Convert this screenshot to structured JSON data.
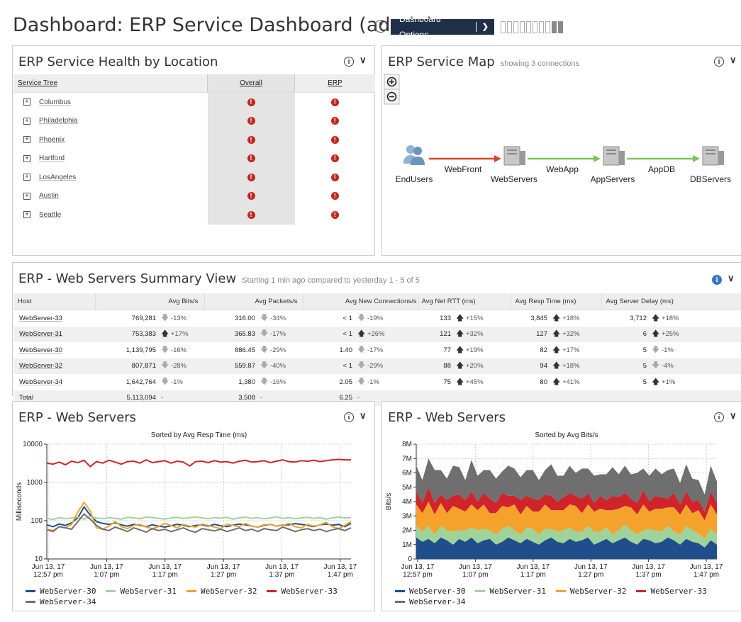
{
  "header": {
    "title": "Dashboard: ERP Service Dashboard (admin)",
    "help_icon": "?",
    "options_label": "Dashboard Options"
  },
  "health": {
    "title": "ERP Service Health by Location",
    "columns": [
      "Service Tree",
      "Overall",
      "ERP"
    ],
    "rows": [
      {
        "location": "Columbus",
        "overall": "!",
        "erp": "!"
      },
      {
        "location": "Philadelphia",
        "overall": "!",
        "erp": "!"
      },
      {
        "location": "Phoenix",
        "overall": "!",
        "erp": "!"
      },
      {
        "location": "Hartford",
        "overall": "!",
        "erp": "!"
      },
      {
        "location": "LosAngeles",
        "overall": "!",
        "erp": "!"
      },
      {
        "location": "Austin",
        "overall": "!",
        "erp": "!"
      },
      {
        "location": "Seattle",
        "overall": "!",
        "erp": "!"
      }
    ]
  },
  "service_map": {
    "title": "ERP Service Map",
    "subtitle": "showing 3 connections",
    "nodes": [
      "EndUsers",
      "WebServers",
      "AppServers",
      "DBServers"
    ],
    "edges": [
      {
        "label": "WebFront",
        "color": "#d9442a"
      },
      {
        "label": "WebApp",
        "color": "#7cc35a"
      },
      {
        "label": "AppDB",
        "color": "#7cc35a"
      }
    ]
  },
  "summary": {
    "title": "ERP - Web Servers Summary View",
    "subtitle": "Starting 1 min ago compared to yesterday 1 - 5 of 5",
    "columns": [
      "Host",
      "Avg Bits/s",
      "Avg Packets/s",
      "Avg New Connections/s",
      "Avg Net RTT (ms)",
      "Avg Resp Time (ms)",
      "Avg Server Delay (ms)"
    ],
    "rows": [
      {
        "host": "WebServer-33",
        "bits": "769,281",
        "bits_chg": "-13%",
        "bits_dir": "down",
        "pkts": "316.00",
        "pkts_chg": "-34%",
        "pkts_dir": "down",
        "conn": "< 1",
        "conn_chg": "-19%",
        "conn_dir": "down",
        "rtt": "133",
        "rtt_chg": "+15%",
        "rtt_dir": "up",
        "resp": "3,845",
        "resp_chg": "+18%",
        "resp_dir": "up",
        "delay": "3,712",
        "delay_chg": "+18%",
        "delay_dir": "up"
      },
      {
        "host": "WebServer-31",
        "bits": "753,383",
        "bits_chg": "+17%",
        "bits_dir": "up",
        "pkts": "365.83",
        "pkts_chg": "-17%",
        "pkts_dir": "down",
        "conn": "< 1",
        "conn_chg": "+26%",
        "conn_dir": "up",
        "rtt": "121",
        "rtt_chg": "+32%",
        "rtt_dir": "up",
        "resp": "127",
        "resp_chg": "+32%",
        "resp_dir": "up",
        "delay": "6",
        "delay_chg": "+25%",
        "delay_dir": "up"
      },
      {
        "host": "WebServer-30",
        "bits": "1,139,795",
        "bits_chg": "-16%",
        "bits_dir": "down",
        "pkts": "886.45",
        "pkts_chg": "-29%",
        "pkts_dir": "down",
        "conn": "1.40",
        "conn_chg": "-17%",
        "conn_dir": "down",
        "rtt": "77",
        "rtt_chg": "+19%",
        "rtt_dir": "up",
        "resp": "82",
        "resp_chg": "+17%",
        "resp_dir": "up",
        "delay": "5",
        "delay_chg": "-1%",
        "delay_dir": "down"
      },
      {
        "host": "WebServer-32",
        "bits": "807,871",
        "bits_chg": "-28%",
        "bits_dir": "down",
        "pkts": "559.87",
        "pkts_chg": "-40%",
        "pkts_dir": "down",
        "conn": "< 1",
        "conn_chg": "-29%",
        "conn_dir": "down",
        "rtt": "88",
        "rtt_chg": "+20%",
        "rtt_dir": "up",
        "resp": "94",
        "resp_chg": "+18%",
        "resp_dir": "up",
        "delay": "5",
        "delay_chg": "-4%",
        "delay_dir": "down"
      },
      {
        "host": "WebServer-34",
        "bits": "1,642,764",
        "bits_chg": "-1%",
        "bits_dir": "down",
        "pkts": "1,380",
        "pkts_chg": "-16%",
        "pkts_dir": "down",
        "conn": "2.05",
        "conn_chg": "-1%",
        "conn_dir": "down",
        "rtt": "75",
        "rtt_chg": "+45%",
        "rtt_dir": "up",
        "resp": "80",
        "resp_chg": "+41%",
        "resp_dir": "up",
        "delay": "5",
        "delay_chg": "+1%",
        "delay_dir": "up"
      }
    ],
    "total": {
      "label": "Total",
      "bits": "5,113,094",
      "bits_chg": "-",
      "pkts": "3,508",
      "pkts_chg": "-",
      "conn": "6.25",
      "conn_chg": "-"
    }
  },
  "colors": {
    "WebServer-30": "#1f4e8c",
    "WebServer-31": "#9fd39a",
    "WebServer-32": "#f4a22c",
    "WebServer-33": "#d0232b",
    "WebServer-34": "#6f6f6f"
  },
  "chart_data": [
    {
      "type": "line",
      "panel_title": "ERP - Web Servers",
      "title": "Sorted by Avg Resp Time (ms)",
      "xlabel": "",
      "ylabel": "Milliseconds",
      "yscale": "log",
      "ylim": [
        10,
        10000
      ],
      "yticks": [
        "10",
        "100",
        "1000",
        "10000"
      ],
      "xticks": [
        "Jun 13, 17\n12:57 pm",
        "Jun 13, 17\n1:07 pm",
        "Jun 13, 17\n1:17 pm",
        "Jun 13, 17\n1:27 pm",
        "Jun 13, 17\n1:37 pm",
        "Jun 13, 17\n1:47 pm"
      ],
      "grid": true,
      "legend": "bottom",
      "series": [
        {
          "name": "WebServer-30",
          "values": [
            78,
            70,
            82,
            75,
            88,
            120,
            230,
            140,
            95,
            85,
            80,
            88,
            78,
            72,
            80,
            76,
            70,
            78,
            72,
            68,
            74,
            80,
            76,
            70,
            75,
            78,
            72,
            80,
            74,
            70,
            76,
            82,
            78,
            72,
            68,
            75,
            80,
            72,
            76,
            78,
            84,
            80,
            75,
            70,
            78,
            82,
            76,
            80,
            70,
            85
          ]
        },
        {
          "name": "WebServer-31",
          "values": [
            115,
            108,
            120,
            112,
            118,
            125,
            110,
            130,
            118,
            112,
            120,
            115,
            110,
            122,
            118,
            112,
            125,
            120,
            115,
            110,
            118,
            122,
            114,
            120,
            125,
            118,
            112,
            120,
            116,
            122,
            110,
            118,
            124,
            115,
            120,
            112,
            118,
            126,
            115,
            120,
            112,
            118,
            122,
            115,
            120,
            110,
            118,
            125,
            118,
            120
          ]
        },
        {
          "name": "WebServer-32",
          "values": [
            60,
            55,
            70,
            65,
            80,
            170,
            300,
            180,
            65,
            60,
            72,
            95,
            70,
            62,
            75,
            80,
            68,
            62,
            70,
            85,
            75,
            65,
            80,
            72,
            68,
            82,
            75,
            68,
            62,
            80,
            75,
            70,
            85,
            72,
            68,
            78,
            80,
            72,
            75,
            85,
            70,
            65,
            80,
            72,
            78,
            90,
            70,
            62,
            75,
            95
          ]
        },
        {
          "name": "WebServer-33",
          "values": [
            3200,
            3000,
            3400,
            2900,
            3600,
            3300,
            3800,
            2600,
            3500,
            3200,
            3800,
            3400,
            3000,
            3500,
            3600,
            3200,
            3900,
            3300,
            3500,
            3700,
            3200,
            3600,
            3400,
            2700,
            3500,
            3600,
            3300,
            3700,
            3400,
            3500,
            3200,
            3600,
            3800,
            3400,
            3500,
            3700,
            3300,
            3600,
            3900,
            3500,
            3400,
            3700,
            3600,
            3800,
            3500,
            3700,
            3900,
            4000,
            3900,
            3900
          ]
        },
        {
          "name": "WebServer-34",
          "values": [
            58,
            52,
            70,
            65,
            60,
            95,
            150,
            110,
            75,
            60,
            55,
            68,
            60,
            52,
            65,
            58,
            50,
            62,
            55,
            60,
            52,
            58,
            65,
            55,
            50,
            62,
            58,
            54,
            60,
            52,
            58,
            65,
            55,
            60,
            52,
            62,
            58,
            55,
            68,
            60,
            52,
            58,
            62,
            55,
            60,
            52,
            58,
            62,
            55,
            65
          ]
        }
      ]
    },
    {
      "type": "area",
      "stacked": true,
      "panel_title": "ERP - Web Servers",
      "title": "Sorted by Avg Bits/s",
      "xlabel": "",
      "ylabel": "Bits/s",
      "ylim": [
        0,
        8
      ],
      "yunit": "M",
      "yticks": [
        "0",
        "1M",
        "2M",
        "3M",
        "4M",
        "5M",
        "6M",
        "7M",
        "8M"
      ],
      "xticks": [
        "Jun 13, 17\n12:57 pm",
        "Jun 13, 17\n1:07 pm",
        "Jun 13, 17\n1:17 pm",
        "Jun 13, 17\n1:27 pm",
        "Jun 13, 17\n1:37 pm",
        "Jun 13, 17\n1:47 pm"
      ],
      "grid": true,
      "legend": "bottom",
      "series": [
        {
          "name": "WebServer-30",
          "values": [
            1.5,
            1.2,
            1.4,
            1.1,
            1.5,
            1.3,
            1.0,
            1.4,
            1.2,
            1.5,
            1.1,
            1.3,
            1.4,
            1.0,
            1.2,
            1.5,
            1.3,
            1.1,
            1.4,
            1.2,
            1.0,
            1.3,
            1.5,
            1.2,
            1.1,
            1.4,
            1.2,
            1.3,
            1.5,
            1.0,
            1.2,
            1.4,
            1.1,
            1.3,
            1.5,
            1.2,
            1.0,
            1.4,
            1.3,
            1.1,
            1.2,
            1.5,
            1.3,
            1.0,
            1.4,
            1.2,
            1.1,
            0.8,
            1.3,
            1.0
          ]
        },
        {
          "name": "WebServer-31",
          "values": [
            0.8,
            0.7,
            0.9,
            0.6,
            0.8,
            0.7,
            0.9,
            0.6,
            0.8,
            0.7,
            0.9,
            0.8,
            0.6,
            0.7,
            0.9,
            0.8,
            0.7,
            0.6,
            0.8,
            0.9,
            0.7,
            0.8,
            0.6,
            0.7,
            0.9,
            0.8,
            0.7,
            0.6,
            0.8,
            0.9,
            0.7,
            0.8,
            0.6,
            0.7,
            0.9,
            0.8,
            0.7,
            0.6,
            0.8,
            0.9,
            0.7,
            0.8,
            0.6,
            0.7,
            0.9,
            0.8,
            0.7,
            0.6,
            0.8,
            0.7
          ]
        },
        {
          "name": "WebServer-32",
          "values": [
            1.5,
            1.3,
            1.7,
            1.4,
            1.6,
            1.2,
            1.8,
            1.5,
            1.3,
            1.6,
            1.4,
            1.7,
            1.2,
            1.5,
            1.6,
            1.3,
            1.8,
            1.4,
            1.5,
            1.2,
            1.6,
            1.7,
            1.3,
            1.5,
            1.4,
            1.6,
            1.8,
            1.3,
            1.5,
            1.4,
            1.6,
            1.2,
            1.7,
            1.5,
            1.3,
            1.6,
            1.4,
            1.8,
            1.2,
            1.5,
            1.6,
            1.3,
            1.7,
            1.4,
            1.5,
            1.2,
            1.6,
            1.3,
            1.7,
            1.4
          ]
        },
        {
          "name": "WebServer-33",
          "values": [
            0.9,
            0.7,
            1.0,
            0.8,
            0.6,
            0.9,
            0.7,
            1.0,
            0.8,
            0.9,
            0.6,
            0.8,
            1.0,
            0.7,
            0.9,
            0.8,
            0.6,
            1.0,
            0.7,
            0.9,
            0.8,
            0.7,
            1.0,
            0.6,
            0.9,
            0.8,
            0.7,
            1.0,
            0.8,
            0.6,
            0.9,
            0.7,
            1.0,
            0.8,
            0.9,
            0.6,
            0.8,
            1.0,
            0.7,
            0.9,
            0.8,
            0.6,
            1.0,
            0.7,
            0.9,
            0.8,
            0.7,
            0.6,
            0.9,
            0.8
          ]
        },
        {
          "name": "WebServer-34",
          "values": [
            1.8,
            1.6,
            2.0,
            2.3,
            1.7,
            1.5,
            2.1,
            1.9,
            1.4,
            2.2,
            1.8,
            1.6,
            2.0,
            1.7,
            1.5,
            2.1,
            1.9,
            1.6,
            1.8,
            2.0,
            1.4,
            1.7,
            2.2,
            1.8,
            1.5,
            1.9,
            1.6,
            2.1,
            1.7,
            1.9,
            1.5,
            1.8,
            2.0,
            1.6,
            1.9,
            1.7,
            2.1,
            1.5,
            1.8,
            1.9,
            1.6,
            2.0,
            1.7,
            1.5,
            1.9,
            1.6,
            1.4,
            1.2,
            1.8,
            1.5
          ]
        }
      ]
    }
  ]
}
